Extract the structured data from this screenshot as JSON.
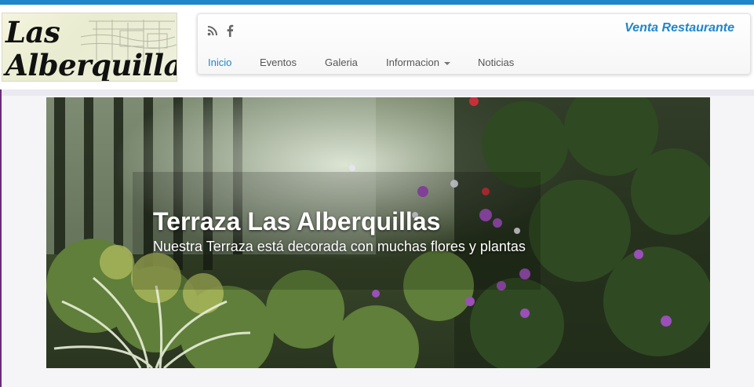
{
  "site": {
    "logo_line1": "Las",
    "logo_line2": "Alberquillas"
  },
  "header": {
    "social_icons": [
      "rss-icon",
      "facebook-icon"
    ],
    "venta_label": "Venta Restaurante"
  },
  "nav": {
    "items": [
      {
        "label": "Inicio",
        "active": true
      },
      {
        "label": "Eventos",
        "active": false
      },
      {
        "label": "Galeria",
        "active": false
      },
      {
        "label": "Informacion",
        "active": false,
        "dropdown": true
      },
      {
        "label": "Noticias",
        "active": false
      }
    ]
  },
  "slider": {
    "title": "Terraza Las Alberquillas",
    "subtitle": "Nuestra Terraza está decorada con muchas flores y plantas"
  },
  "colors": {
    "accent": "#1f86c9",
    "top_bar": "#1f86c9",
    "left_accent": "#6b2a7a"
  }
}
